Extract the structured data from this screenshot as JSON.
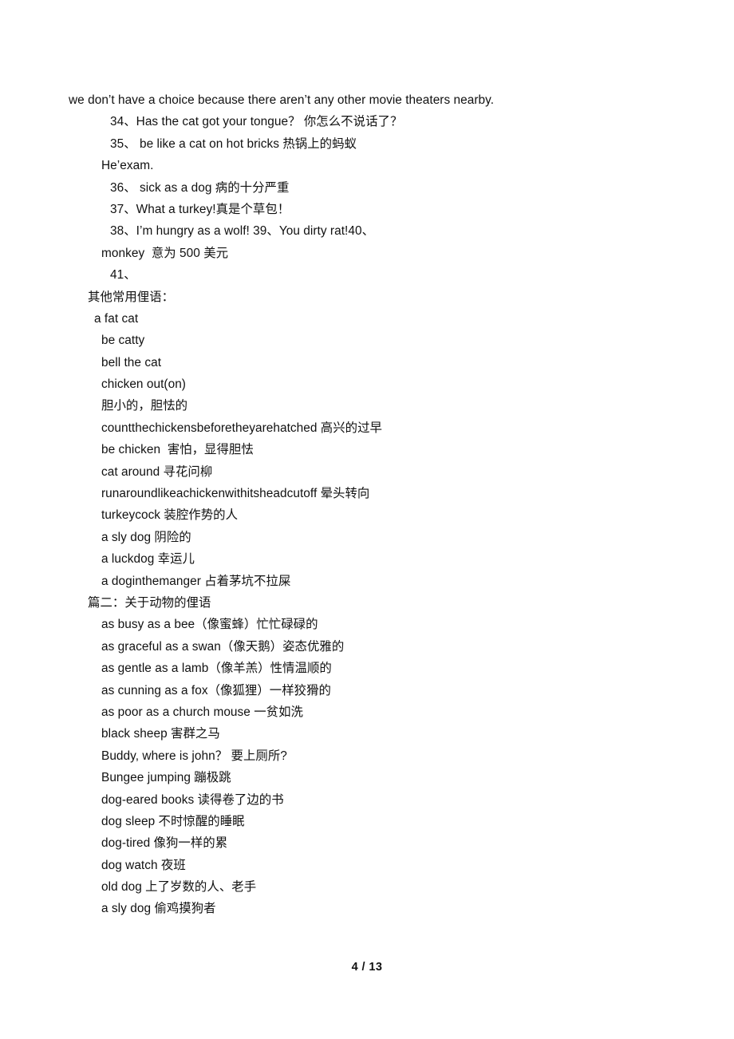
{
  "document": {
    "page_label": "4 / 13",
    "page_number": "4",
    "total_pages": "13",
    "text_color": "#111111",
    "background_color": "#ffffff"
  },
  "body": {
    "lines": [
      {
        "id": "l01",
        "indent": 0,
        "text": "we don’t have a choice because there aren’t any other movie theaters nearby."
      },
      {
        "id": "l02",
        "indent": 4,
        "text": "34、Has the cat got your tongue？ 你怎么不说话了？"
      },
      {
        "id": "l03",
        "indent": 4,
        "text": "35、 be like a cat on hot bricks 热锅上的蚂蚁"
      },
      {
        "id": "l04",
        "indent": 3,
        "text": "He’exam."
      },
      {
        "id": "l05",
        "indent": 4,
        "text": "36、 sick as a dog 病的十分严重"
      },
      {
        "id": "l06",
        "indent": 4,
        "text": "37、What a turkey!真是个草包！"
      },
      {
        "id": "l07",
        "indent": 4,
        "text": "38、I’m hungry as a wolf! 39、You dirty rat!40、"
      },
      {
        "id": "l08",
        "indent": 3,
        "text": "monkey  意为 500 美元"
      },
      {
        "id": "l09",
        "indent": 4,
        "text": "41、"
      },
      {
        "id": "l10",
        "indent": 1,
        "text": "其他常用俚语："
      },
      {
        "id": "l11",
        "indent": 2,
        "text": "a fat cat"
      },
      {
        "id": "l12",
        "indent": 3,
        "text": "be catty"
      },
      {
        "id": "l13",
        "indent": 3,
        "text": "bell the cat"
      },
      {
        "id": "l14",
        "indent": 3,
        "text": "chicken out(on)"
      },
      {
        "id": "l15",
        "indent": 3,
        "text": "胆小的，胆怯的"
      },
      {
        "id": "l16",
        "indent": 3,
        "text": "countthechickensbeforetheyarehatched 高兴的过早"
      },
      {
        "id": "l17",
        "indent": 3,
        "text": "be chicken  害怕，显得胆怯"
      },
      {
        "id": "l18",
        "indent": 3,
        "text": "cat around 寻花问柳"
      },
      {
        "id": "l19",
        "indent": 3,
        "text": "runaroundlikeachickenwithitsheadcutoff 晕头转向"
      },
      {
        "id": "l20",
        "indent": 3,
        "text": "turkeycock 装腔作势的人"
      },
      {
        "id": "l21",
        "indent": 3,
        "text": "a sly dog 阴险的"
      },
      {
        "id": "l22",
        "indent": 3,
        "text": "a luckdog 幸运儿"
      },
      {
        "id": "l23",
        "indent": 3,
        "text": "a doginthemanger 占着茅坑不拉屎"
      },
      {
        "id": "l24",
        "indent": 1,
        "text": "篇二：关于动物的俚语"
      },
      {
        "id": "l25",
        "indent": 3,
        "text": "as busy as a bee（像蜜蜂）忙忙碌碌的"
      },
      {
        "id": "l26",
        "indent": 3,
        "text": "as graceful as a swan（像天鹅）姿态优雅的"
      },
      {
        "id": "l27",
        "indent": 3,
        "text": "as gentle as a lamb（像羊羔）性情温顺的"
      },
      {
        "id": "l28",
        "indent": 3,
        "text": "as cunning as a fox（像狐狸）一样狡猾的"
      },
      {
        "id": "l29",
        "indent": 3,
        "text": "as poor as a church mouse 一贫如洗"
      },
      {
        "id": "l30",
        "indent": 3,
        "text": "black sheep 害群之马"
      },
      {
        "id": "l31",
        "indent": 3,
        "text": "Buddy, where is john？ 要上厕所?"
      },
      {
        "id": "l32",
        "indent": 3,
        "text": "Bungee jumping 蹦极跳"
      },
      {
        "id": "l33",
        "indent": 3,
        "text": "dog-eared books 读得卷了边的书"
      },
      {
        "id": "l34",
        "indent": 3,
        "text": "dog sleep 不时惊醒的睡眠"
      },
      {
        "id": "l35",
        "indent": 3,
        "text": "dog-tired 像狗一样的累"
      },
      {
        "id": "l36",
        "indent": 3,
        "text": "dog watch 夜班"
      },
      {
        "id": "l37",
        "indent": 3,
        "text": "old dog 上了岁数的人、老手"
      },
      {
        "id": "l38",
        "indent": 3,
        "text": "a sly dog 偷鸡摸狗者"
      }
    ]
  }
}
